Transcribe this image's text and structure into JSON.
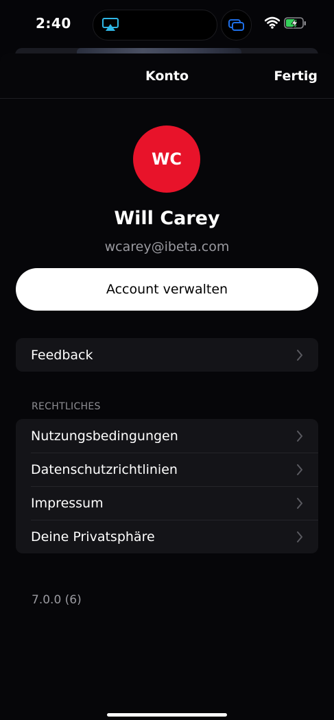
{
  "status_bar": {
    "time": "2:40"
  },
  "nav": {
    "title": "Konto",
    "done_label": "Fertig"
  },
  "profile": {
    "initials": "WC",
    "name": "Will Carey",
    "email": "wcarey@ibeta.com"
  },
  "manage_button": {
    "label": "Account verwalten"
  },
  "feedback": {
    "label": "Feedback"
  },
  "legal": {
    "header": "RECHTLICHES",
    "items": [
      {
        "label": "Nutzungsbedingungen"
      },
      {
        "label": "Datenschutzrichtlinien"
      },
      {
        "label": "Impressum"
      },
      {
        "label": "Deine Privatsphäre"
      }
    ]
  },
  "version": "7.0.0 (6)",
  "colors": {
    "avatar": "#e8132a",
    "background": "#060609",
    "cell": "#141418",
    "airplay": "#2fb7e6",
    "screen_share": "#1e6fe8",
    "battery_fill": "#35d05a"
  },
  "icons": [
    "airplay-icon",
    "screen-share-icon",
    "wifi-icon",
    "battery-charging-icon",
    "chevron-right-icon"
  ]
}
